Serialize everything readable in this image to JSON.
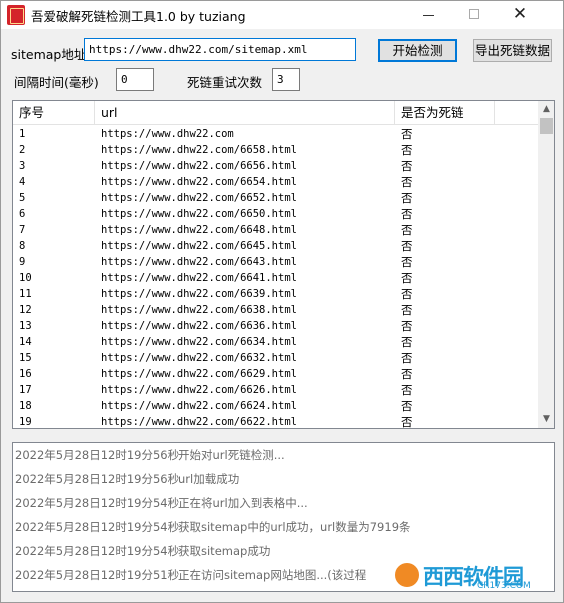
{
  "window": {
    "title": "吾爱破解死链检测工具1.0 by tuziang"
  },
  "form": {
    "sitemap_label": "sitemap地址",
    "sitemap_value": "https://www.dhw22.com/sitemap.xml",
    "interval_label": "间隔时间(毫秒)",
    "interval_value": "0",
    "retry_label": "死链重试次数",
    "retry_value": "3",
    "start_button": "开始检测",
    "export_button": "导出死链数据"
  },
  "table": {
    "headers": [
      "序号",
      "url",
      "是否为死链"
    ],
    "rows": [
      {
        "n": "1",
        "url": "https://www.dhw22.com",
        "dead": "否"
      },
      {
        "n": "2",
        "url": "https://www.dhw22.com/6658.html",
        "dead": "否"
      },
      {
        "n": "3",
        "url": "https://www.dhw22.com/6656.html",
        "dead": "否"
      },
      {
        "n": "4",
        "url": "https://www.dhw22.com/6654.html",
        "dead": "否"
      },
      {
        "n": "5",
        "url": "https://www.dhw22.com/6652.html",
        "dead": "否"
      },
      {
        "n": "6",
        "url": "https://www.dhw22.com/6650.html",
        "dead": "否"
      },
      {
        "n": "7",
        "url": "https://www.dhw22.com/6648.html",
        "dead": "否"
      },
      {
        "n": "8",
        "url": "https://www.dhw22.com/6645.html",
        "dead": "否"
      },
      {
        "n": "9",
        "url": "https://www.dhw22.com/6643.html",
        "dead": "否"
      },
      {
        "n": "10",
        "url": "https://www.dhw22.com/6641.html",
        "dead": "否"
      },
      {
        "n": "11",
        "url": "https://www.dhw22.com/6639.html",
        "dead": "否"
      },
      {
        "n": "12",
        "url": "https://www.dhw22.com/6638.html",
        "dead": "否"
      },
      {
        "n": "13",
        "url": "https://www.dhw22.com/6636.html",
        "dead": "否"
      },
      {
        "n": "14",
        "url": "https://www.dhw22.com/6634.html",
        "dead": "否"
      },
      {
        "n": "15",
        "url": "https://www.dhw22.com/6632.html",
        "dead": "否"
      },
      {
        "n": "16",
        "url": "https://www.dhw22.com/6629.html",
        "dead": "否"
      },
      {
        "n": "17",
        "url": "https://www.dhw22.com/6626.html",
        "dead": "否"
      },
      {
        "n": "18",
        "url": "https://www.dhw22.com/6624.html",
        "dead": "否"
      },
      {
        "n": "19",
        "url": "https://www.dhw22.com/6622.html",
        "dead": "否"
      }
    ]
  },
  "log": [
    {
      "time": "2022年5月28日12时19分56秒",
      "msg": "开始对url死链检测..."
    },
    {
      "time": "2022年5月28日12时19分56秒",
      "msg": "url加载成功"
    },
    {
      "time": "2022年5月28日12时19分54秒",
      "msg": "正在将url加入到表格中..."
    },
    {
      "time": "2022年5月28日12时19分54秒",
      "msg": "获取sitemap中的url成功，url数量为7919条"
    },
    {
      "time": "2022年5月28日12时19分54秒",
      "msg": "获取sitemap成功"
    },
    {
      "time": "2022年5月28日12时19分51秒",
      "msg": "正在访问sitemap网站地图...(该过程"
    }
  ],
  "watermark": {
    "text": "西西软件园",
    "sub": "CR173.COM"
  },
  "icons": {
    "app": "app-icon",
    "minimize": "minimize-icon",
    "maximize": "maximize-icon",
    "close": "close-icon",
    "scroll_up": "chevron-up-icon",
    "scroll_down": "chevron-down-icon"
  },
  "colors": {
    "focus_border": "#0078d7",
    "log_text": "#6b6b6b",
    "watermark_blue": "#1f9ad6",
    "watermark_orange": "#f08a24"
  }
}
